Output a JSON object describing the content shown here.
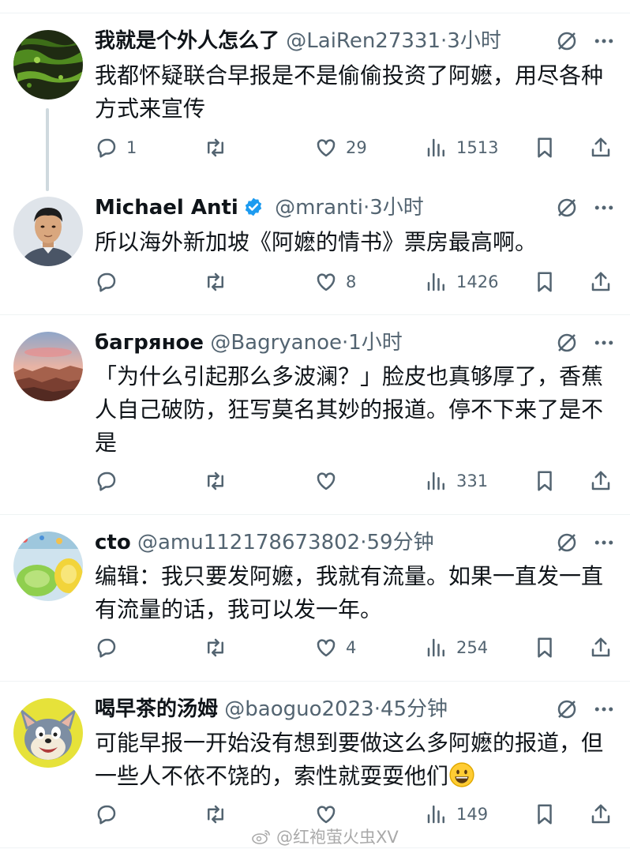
{
  "tweets": [
    {
      "name": "我就是个外人怎么了",
      "handle": "@LaiRen27331",
      "dot": "·",
      "time": "3小时",
      "verified": false,
      "text": "我都怀疑联合早报是不是偷偷投资了阿嬷，用尽各种方式来宣传",
      "replies": "1",
      "retweets": "",
      "likes": "29",
      "views": "1513",
      "avatar": "green-abstract"
    },
    {
      "name": "Michael Anti",
      "handle": "@mranti",
      "dot": "·",
      "time": "3小时",
      "verified": true,
      "text": "所以海外新加坡《阿嬷的情书》票房最高啊。",
      "replies": "",
      "retweets": "",
      "likes": "8",
      "views": "1426",
      "avatar": "man-portrait"
    },
    {
      "name": "багряное",
      "handle": "@Bagryanoe",
      "dot": "·",
      "time": "1小时",
      "verified": false,
      "text": "「为什么引起那么多波澜？」脸皮也真够厚了，香蕉人自己破防，狂写莫名其妙的报道。停不下来了是不是",
      "replies": "",
      "retweets": "",
      "likes": "",
      "views": "331",
      "avatar": "canyon-sunset"
    },
    {
      "name": "cto",
      "handle": "@amu112178673802",
      "dot": "·",
      "time": "59分钟",
      "verified": false,
      "text": "编辑：我只要发阿嬷，我就有流量。如果一直发一直有流量的话，我可以发一年。",
      "replies": "",
      "retweets": "",
      "likes": "4",
      "views": "254",
      "avatar": "colorful-objects"
    },
    {
      "name": "喝早茶的汤姆",
      "handle": "@baoguo2023",
      "dot": "·",
      "time": "45分钟",
      "verified": false,
      "text": "可能早报一开始没有想到要做这么多阿嬷的报道，但一些人不依不饶的，索性就耍耍他们",
      "emoji": "grinning-face",
      "replies": "",
      "retweets": "",
      "likes": "",
      "views": "149",
      "avatar": "cartoon-cat"
    }
  ],
  "icons": {
    "reply": "reply-icon",
    "retweet": "retweet-icon",
    "like": "heart-icon",
    "views": "views-icon",
    "bookmark": "bookmark-icon",
    "share": "share-icon",
    "grok": "grok-icon",
    "more": "more-icon"
  },
  "colors": {
    "text": "#0f1419",
    "secondary": "#536471",
    "divider": "#eff3f4",
    "verified": "#1d9bf0"
  },
  "watermark": "@红袍萤火虫XV"
}
